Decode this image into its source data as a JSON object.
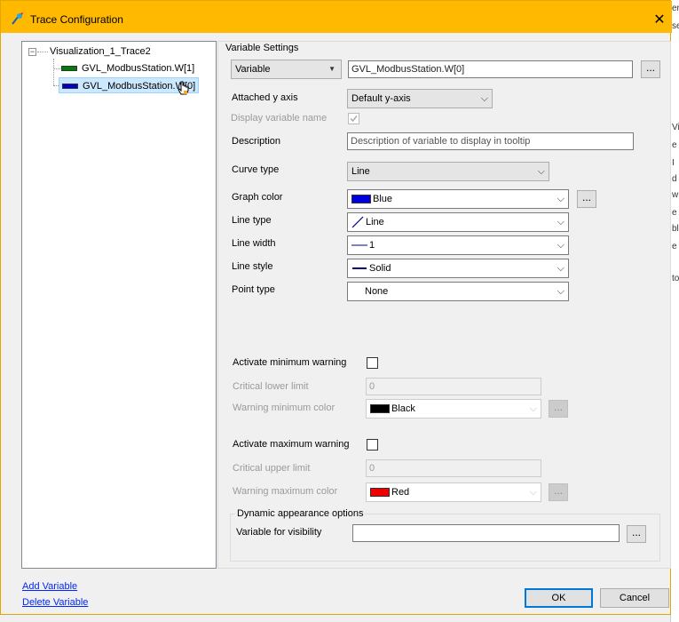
{
  "window": {
    "title": "Trace Configuration"
  },
  "background_app": {
    "fragments": [
      "er",
      "se",
      "",
      "Vi",
      "e",
      "I",
      "d",
      "w",
      "e",
      "bl",
      "e",
      "to"
    ]
  },
  "tree": {
    "root_label": "Visualization_1_Trace2",
    "items": [
      {
        "label": "GVL_ModbusStation.W[1]",
        "color": "#008000"
      },
      {
        "label": "GVL_ModbusStation.W[0]",
        "color": "#0000cc"
      }
    ]
  },
  "settings": {
    "group_title": "Variable Settings",
    "variable_combo": "Variable",
    "variable_value": "GVL_ModbusStation.W[0]",
    "browse_label": "...",
    "attached_y_axis": {
      "label": "Attached y axis",
      "value": "Default y-axis"
    },
    "display_variable_name": {
      "label": "Display variable name",
      "checked": true
    },
    "description": {
      "label": "Description",
      "value": "Description of variable to display in tooltip"
    },
    "curve_type": {
      "label": "Curve type",
      "value": "Line"
    },
    "graph_color": {
      "label": "Graph color",
      "value": "Blue",
      "color": "#0000dd"
    },
    "line_type": {
      "label": "Line type",
      "value": "Line"
    },
    "line_width": {
      "label": "Line width",
      "value": "1"
    },
    "line_style": {
      "label": "Line style",
      "value": "Solid"
    },
    "point_type": {
      "label": "Point type",
      "value": "None"
    },
    "min_warning": {
      "activate_label": "Activate minimum warning",
      "limit_label": "Critical lower limit",
      "limit_value": "0",
      "color_label": "Warning minimum color",
      "color_value": "Black",
      "color": "#000000"
    },
    "max_warning": {
      "activate_label": "Activate maximum warning",
      "limit_label": "Critical upper limit",
      "limit_value": "0",
      "color_label": "Warning maximum color",
      "color_value": "Red",
      "color": "#ee0000"
    },
    "dynamic": {
      "title": "Dynamic appearance options",
      "visibility_label": "Variable for visibility",
      "visibility_value": ""
    }
  },
  "footer": {
    "add_variable": "Add Variable",
    "delete_variable": "Delete Variable",
    "ok": "OK",
    "cancel": "Cancel"
  }
}
